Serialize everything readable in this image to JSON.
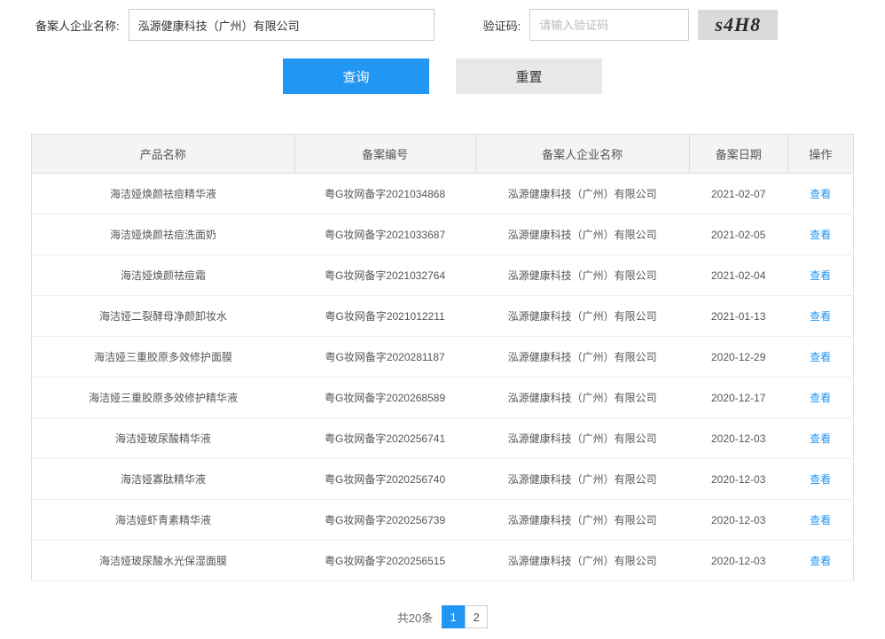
{
  "form": {
    "company_label": "备案人企业名称:",
    "company_value": "泓源健康科技（广州）有限公司",
    "captcha_label": "验证码:",
    "captcha_placeholder": "请输入验证码",
    "captcha_image_text": "s4H8",
    "search_button": "查询",
    "reset_button": "重置"
  },
  "table": {
    "headers": {
      "product": "产品名称",
      "number": "备案编号",
      "company": "备案人企业名称",
      "date": "备案日期",
      "action": "操作"
    },
    "action_label": "查看",
    "rows": [
      {
        "product": "海洁娅焕颜祛痘精华液",
        "number": "粤G妆网备字2021034868",
        "company": "泓源健康科技（广州）有限公司",
        "date": "2021-02-07"
      },
      {
        "product": "海洁娅焕颜祛痘洗面奶",
        "number": "粤G妆网备字2021033687",
        "company": "泓源健康科技（广州）有限公司",
        "date": "2021-02-05"
      },
      {
        "product": "海洁娅焕颜祛痘霜",
        "number": "粤G妆网备字2021032764",
        "company": "泓源健康科技（广州）有限公司",
        "date": "2021-02-04"
      },
      {
        "product": "海洁娅二裂酵母净颜卸妆水",
        "number": "粤G妆网备字2021012211",
        "company": "泓源健康科技（广州）有限公司",
        "date": "2021-01-13"
      },
      {
        "product": "海洁娅三重胶原多效修护面膜",
        "number": "粤G妆网备字2020281187",
        "company": "泓源健康科技（广州）有限公司",
        "date": "2020-12-29"
      },
      {
        "product": "海洁娅三重胶原多效修护精华液",
        "number": "粤G妆网备字2020268589",
        "company": "泓源健康科技（广州）有限公司",
        "date": "2020-12-17"
      },
      {
        "product": "海洁娅玻尿酸精华液",
        "number": "粤G妆网备字2020256741",
        "company": "泓源健康科技（广州）有限公司",
        "date": "2020-12-03"
      },
      {
        "product": "海洁娅寡肽精华液",
        "number": "粤G妆网备字2020256740",
        "company": "泓源健康科技（广州）有限公司",
        "date": "2020-12-03"
      },
      {
        "product": "海洁娅虾青素精华液",
        "number": "粤G妆网备字2020256739",
        "company": "泓源健康科技（广州）有限公司",
        "date": "2020-12-03"
      },
      {
        "product": "海洁娅玻尿酸水光保湿面膜",
        "number": "粤G妆网备字2020256515",
        "company": "泓源健康科技（广州）有限公司",
        "date": "2020-12-03"
      }
    ]
  },
  "pagination": {
    "total_text": "共20条",
    "current_page": "1",
    "pages": [
      "1",
      "2"
    ]
  }
}
